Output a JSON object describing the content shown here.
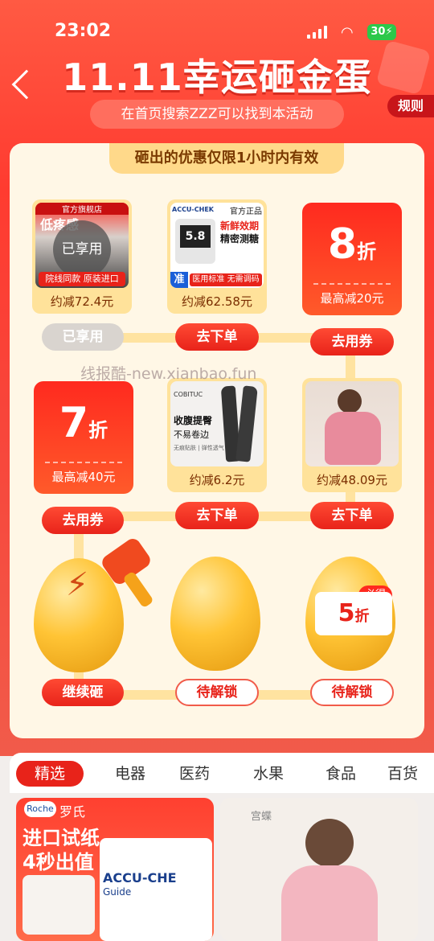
{
  "status": {
    "time": "23:02",
    "battery": "30"
  },
  "header": {
    "title": "11.11幸运砸金蛋",
    "subtitle": "在首页搜索ZZZ可以找到本活动",
    "rules": "规则"
  },
  "notice": "砸出的优惠仅限1小时内有效",
  "row1": {
    "card1": {
      "store": "官方旗舰店",
      "overlay": "已享用",
      "promo": "院线同款 原装进口",
      "brand_text": "低疼感",
      "price": "约减72.4元",
      "button": "已享用"
    },
    "card2": {
      "store": "官方正品",
      "brand": "ACCU-CHEK",
      "headline1": "新鲜效期",
      "headline2": "精密测糖",
      "screen": "5.8",
      "stamp": "准",
      "footer": "医用标准 无需调码",
      "price": "约减62.58元",
      "button": "去下单"
    },
    "coupon": {
      "value": "8",
      "unit": "折",
      "cap": "最高减20元",
      "button": "去用券"
    }
  },
  "row2": {
    "coupon": {
      "value": "7",
      "unit": "折",
      "cap": "最高减40元",
      "button": "去用券"
    },
    "card2": {
      "brand": "COBITUC",
      "headline1": "收腹提臀",
      "headline2": "不易卷边",
      "footer": "无痕贴肤 | 弹性透气",
      "price": "约减6.2元",
      "button": "去下单"
    },
    "card3": {
      "price": "约减48.09元",
      "button": "去下单"
    }
  },
  "eggs": {
    "egg1": {
      "button": "继续砸"
    },
    "egg2": {
      "button": "待解锁"
    },
    "egg3": {
      "button": "待解锁",
      "badge_value": "5",
      "badge_unit": "折",
      "tag": "必得"
    }
  },
  "watermark": "线报酷-new.xianbao.fun",
  "tabs": [
    "精选",
    "电器",
    "医药",
    "水果",
    "食品",
    "百货"
  ],
  "feed": {
    "card1": {
      "brand_logo": "Roche",
      "brand": "罗氏",
      "line1": "进口试纸",
      "line2": "4秒出值",
      "product": "ACCU-CHE",
      "sub": "Guide"
    },
    "card2": {
      "brand": "宫蝶"
    }
  },
  "colors": {
    "accent": "#e8231a",
    "panel": "#fff7e6",
    "gold": "#ffd98a"
  }
}
